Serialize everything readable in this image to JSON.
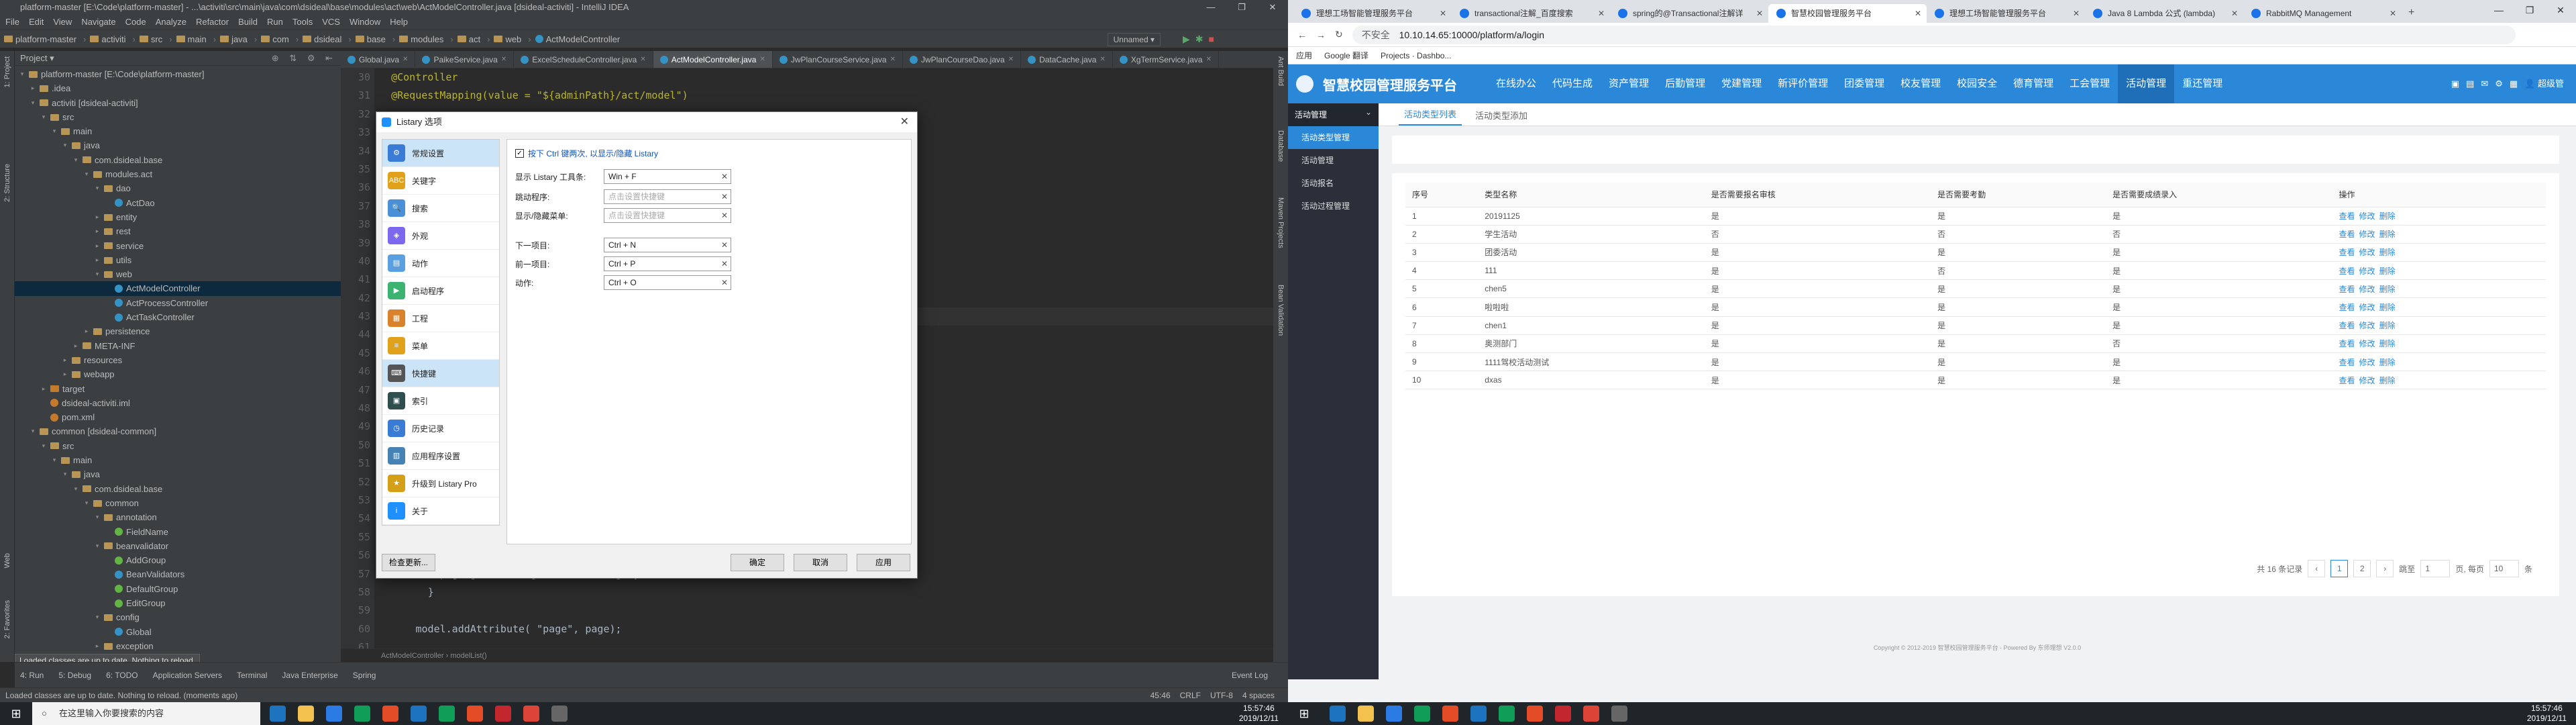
{
  "ide": {
    "title": "platform-master [E:\\Code\\platform-master] - ...\\activiti\\src\\main\\java\\com\\dsideal\\base\\modules\\act\\web\\ActModelController.java [dsideal-activiti] - IntelliJ IDEA",
    "window_controls": [
      "—",
      "❐",
      "✕"
    ],
    "menu": [
      "File",
      "Edit",
      "View",
      "Navigate",
      "Code",
      "Analyze",
      "Refactor",
      "Build",
      "Run",
      "Tools",
      "VCS",
      "Window",
      "Help"
    ],
    "breadcrumb": [
      "platform-master",
      "activiti",
      "src",
      "main",
      "java",
      "com",
      "dsideal",
      "base",
      "modules",
      "act",
      "web",
      "ActModelController"
    ],
    "run_config": "Unnamed ▾",
    "project_label": "Project ▾",
    "side_tabs": [
      "1: Project",
      "2: Structure",
      "Web",
      "2: Favorites"
    ],
    "right_tabs": [
      "Ant Build",
      "Database",
      "Maven Projects",
      "Bean Validation"
    ],
    "tree": [
      {
        "label": "platform-master [E:\\Code\\platform-master]",
        "depth": 0,
        "kind": "folder",
        "arrow": "▾"
      },
      {
        "label": ".idea",
        "depth": 1,
        "kind": "folder",
        "arrow": "▸"
      },
      {
        "label": "activiti [dsideal-activiti]",
        "depth": 1,
        "kind": "folder",
        "arrow": "▾"
      },
      {
        "label": "src",
        "depth": 2,
        "kind": "folder",
        "arrow": "▾"
      },
      {
        "label": "main",
        "depth": 3,
        "kind": "folder",
        "arrow": "▾"
      },
      {
        "label": "java",
        "depth": 4,
        "kind": "folder",
        "arrow": "▾"
      },
      {
        "label": "com.dsideal.base",
        "depth": 5,
        "kind": "folder",
        "arrow": "▾"
      },
      {
        "label": "modules.act",
        "depth": 6,
        "kind": "folder",
        "arrow": "▾"
      },
      {
        "label": "dao",
        "depth": 7,
        "kind": "folder",
        "arrow": "▾"
      },
      {
        "label": "ActDao",
        "depth": 8,
        "kind": "class",
        "arrow": ""
      },
      {
        "label": "entity",
        "depth": 7,
        "kind": "folder",
        "arrow": "▸"
      },
      {
        "label": "rest",
        "depth": 7,
        "kind": "folder",
        "arrow": "▸"
      },
      {
        "label": "service",
        "depth": 7,
        "kind": "folder",
        "arrow": "▸"
      },
      {
        "label": "utils",
        "depth": 7,
        "kind": "folder",
        "arrow": "▸"
      },
      {
        "label": "web",
        "depth": 7,
        "kind": "folder",
        "arrow": "▾"
      },
      {
        "label": "ActModelController",
        "depth": 8,
        "kind": "class",
        "arrow": "",
        "selected": true
      },
      {
        "label": "ActProcessController",
        "depth": 8,
        "kind": "class",
        "arrow": ""
      },
      {
        "label": "ActTaskController",
        "depth": 8,
        "kind": "class",
        "arrow": ""
      },
      {
        "label": "persistence",
        "depth": 6,
        "kind": "folder",
        "arrow": "▸"
      },
      {
        "label": "META-INF",
        "depth": 5,
        "kind": "folder",
        "arrow": "▸"
      },
      {
        "label": "resources",
        "depth": 4,
        "kind": "folder",
        "arrow": "▸"
      },
      {
        "label": "webapp",
        "depth": 4,
        "kind": "folder",
        "arrow": "▸"
      },
      {
        "label": "target",
        "depth": 2,
        "kind": "folder-o",
        "arrow": "▸"
      },
      {
        "label": "dsideal-activiti.iml",
        "depth": 2,
        "kind": "file",
        "arrow": ""
      },
      {
        "label": "pom.xml",
        "depth": 2,
        "kind": "file",
        "arrow": ""
      },
      {
        "label": "common [dsideal-common]",
        "depth": 1,
        "kind": "folder",
        "arrow": "▾"
      },
      {
        "label": "src",
        "depth": 2,
        "kind": "folder",
        "arrow": "▾"
      },
      {
        "label": "main",
        "depth": 3,
        "kind": "folder",
        "arrow": "▾"
      },
      {
        "label": "java",
        "depth": 4,
        "kind": "folder",
        "arrow": "▾"
      },
      {
        "label": "com.dsideal.base",
        "depth": 5,
        "kind": "folder",
        "arrow": "▾"
      },
      {
        "label": "common",
        "depth": 6,
        "kind": "folder",
        "arrow": "▾"
      },
      {
        "label": "annotation",
        "depth": 7,
        "kind": "folder",
        "arrow": "▾"
      },
      {
        "label": "FieldName",
        "depth": 8,
        "kind": "class-g",
        "arrow": ""
      },
      {
        "label": "beanvalidator",
        "depth": 7,
        "kind": "folder",
        "arrow": "▾"
      },
      {
        "label": "AddGroup",
        "depth": 8,
        "kind": "class-g",
        "arrow": ""
      },
      {
        "label": "BeanValidators",
        "depth": 8,
        "kind": "class",
        "arrow": ""
      },
      {
        "label": "DefaultGroup",
        "depth": 8,
        "kind": "class-g",
        "arrow": ""
      },
      {
        "label": "EditGroup",
        "depth": 8,
        "kind": "class-g",
        "arrow": ""
      },
      {
        "label": "config",
        "depth": 7,
        "kind": "folder",
        "arrow": "▾"
      },
      {
        "label": "Global",
        "depth": 8,
        "kind": "class",
        "arrow": ""
      },
      {
        "label": "exception",
        "depth": 7,
        "kind": "folder",
        "arrow": "▸"
      }
    ],
    "tabs": [
      {
        "label": "Global.java",
        "active": false
      },
      {
        "label": "PaikeService.java",
        "active": false
      },
      {
        "label": "ExcelScheduleController.java",
        "active": false
      },
      {
        "label": "ActModelController.java",
        "active": true
      },
      {
        "label": "JwPlanCourseService.java",
        "active": false
      },
      {
        "label": "JwPlanCourseDao.java",
        "active": false
      },
      {
        "label": "DataCache.java",
        "active": false
      },
      {
        "label": "XgTermService.java",
        "active": false
      }
    ],
    "line_numbers": [
      "30",
      "31",
      "32",
      "33",
      "34",
      "35",
      "36",
      "37",
      "38",
      "39",
      "40",
      "41",
      "42",
      "43",
      "44",
      "45",
      "46",
      "47",
      "48",
      "49",
      "50",
      "51",
      "52",
      "53",
      "54",
      "55",
      "56",
      "57",
      "58",
      "59",
      "60",
      "61",
      "62"
    ],
    "code_lines": [
      {
        "text": "@Controller",
        "cls": "ann",
        "indent": 1
      },
      {
        "text": "@RequestMapping(value = \"${adminPath}/act/model\")",
        "cls": "ann",
        "indent": 1
      },
      {
        "text": "",
        "cls": "",
        "indent": 0
      },
      {
        "text": "",
        "cls": "",
        "indent": 0
      },
      {
        "text": "",
        "cls": "",
        "indent": 0
      },
      {
        "text": "",
        "cls": "",
        "indent": 0
      },
      {
        "text": "",
        "cls": "",
        "indent": 0
      },
      {
        "text": "",
        "cls": "",
        "indent": 0
      },
      {
        "text": "",
        "cls": "",
        "indent": 0
      },
      {
        "text": "",
        "cls": "",
        "indent": 0
      },
      {
        "text": "",
        "cls": "",
        "indent": 0
      },
      {
        "text": "",
        "cls": "",
        "indent": 0
      },
      {
        "text": "sponse response, Model model) {",
        "cls": "",
        "indent": 44
      },
      {
        "text": "",
        "cls": "",
        "indent": 0,
        "cur": true
      },
      {
        "text": "",
        "cls": "",
        "indent": 0
      },
      {
        "text": "",
        "cls": "",
        "indent": 0
      },
      {
        "text": "",
        "cls": "",
        "indent": 0
      },
      {
        "text": "",
        "cls": "",
        "indent": 0
      },
      {
        "text": "",
        "cls": "",
        "indent": 0
      },
      {
        "text": "egory);",
        "cls": "",
        "indent": 44
      },
      {
        "text": "",
        "cls": "",
        "indent": 0
      },
      {
        "text": "",
        "cls": "",
        "indent": 0
      },
      {
        "text": "",
        "cls": "",
        "indent": 0
      },
      {
        "text": "",
        "cls": "",
        "indent": 0
      },
      {
        "text": "",
        "cls": "",
        "indent": 0
      },
      {
        "text": "",
        "cls": "",
        "indent": 0
      },
      {
        "text": "",
        "cls": "",
        "indent": 0
      },
      {
        "text": "page.getList().get(1).setCategory(\"无分类\");",
        "cls": "",
        "indent": 9
      },
      {
        "text": "}",
        "cls": "",
        "indent": 7
      },
      {
        "text": "",
        "cls": "",
        "indent": 0
      },
      {
        "text": "model.addAttribute( \"page\", page);",
        "cls": "",
        "indent": 5
      },
      {
        "text": "",
        "cls": "",
        "indent": 0
      },
      {
        "text": "",
        "cls": "",
        "indent": 0
      }
    ],
    "editor_breadcrumb": "ActModelController  ›  modelList()",
    "bottom_tools": [
      "4: Run",
      "5: Debug",
      "6: TODO",
      "Application Servers",
      "Terminal",
      "Java Enterprise",
      "Spring",
      "Event Log"
    ],
    "notification": "Loaded classes are up to date. Nothing to reload.",
    "status": "Loaded classes are up to date. Nothing to reload. (moments ago)",
    "status_right": [
      "45:46",
      "CRLF",
      "UTF-8",
      "4 spaces"
    ]
  },
  "dialog": {
    "title": "Listary 选项",
    "close": "✕",
    "nav": [
      {
        "label": "常规设置",
        "color": "#3a7bd5",
        "icon": "⚙",
        "selected": true
      },
      {
        "label": "关键字",
        "color": "#e0a21b",
        "icon": "ABC",
        "selected": false
      },
      {
        "label": "搜索",
        "color": "#4a90d9",
        "icon": "🔍",
        "selected": false
      },
      {
        "label": "外观",
        "color": "#7b68ee",
        "icon": "◈",
        "selected": false
      },
      {
        "label": "动作",
        "color": "#5aa0e0",
        "icon": "▤",
        "selected": false
      },
      {
        "label": "启动程序",
        "color": "#3cb371",
        "icon": "▶",
        "selected": false
      },
      {
        "label": "工程",
        "color": "#d9822b",
        "icon": "▦",
        "selected": false
      },
      {
        "label": "菜单",
        "color": "#e0a21b",
        "icon": "≡",
        "selected": false
      },
      {
        "label": "快捷键",
        "color": "#555555",
        "icon": "⌨",
        "selected": true
      },
      {
        "label": "索引",
        "color": "#2f4f4f",
        "icon": "▣",
        "selected": false
      },
      {
        "label": "历史记录",
        "color": "#3a7bd5",
        "icon": "◷",
        "selected": false
      },
      {
        "label": "应用程序设置",
        "color": "#4682b4",
        "icon": "▥",
        "selected": false
      },
      {
        "label": "升级到 Listary Pro",
        "color": "#d4a017",
        "icon": "★",
        "selected": false
      },
      {
        "label": "关于",
        "color": "#1e90ff",
        "icon": "i",
        "selected": false
      }
    ],
    "checkbox_label": "按下 Ctrl 键两次, 以显示/隐藏 Listary",
    "checkbox_checked": "✓",
    "fields": [
      {
        "label": "显示 Listary 工具条:",
        "value": "Win + F",
        "placeholder": false
      },
      {
        "label": "跳动程序:",
        "value": "点击设置快捷键",
        "placeholder": true
      },
      {
        "label": "显示/隐藏菜单:",
        "value": "点击设置快捷键",
        "placeholder": true
      },
      {
        "label": "下一项目:",
        "value": "Ctrl + N",
        "placeholder": false
      },
      {
        "label": "前一项目:",
        "value": "Ctrl + P",
        "placeholder": false
      },
      {
        "label": "动作:",
        "value": "Ctrl + O",
        "placeholder": false
      }
    ],
    "buttons": {
      "check_update": "检查更新...",
      "ok": "确定",
      "cancel": "取消",
      "apply": "应用"
    }
  },
  "browser": {
    "tabs": [
      {
        "label": "理想工场智能管理服务平台",
        "active": false
      },
      {
        "label": "transactional注解_百度搜索",
        "active": false
      },
      {
        "label": "spring的@Transactional注解详",
        "active": false
      },
      {
        "label": "智慧校园管理服务平台",
        "active": true
      },
      {
        "label": "理想工场智能管理服务平台",
        "active": false
      },
      {
        "label": "Java 8 Lambda 公式 (lambda)",
        "active": false
      },
      {
        "label": "RabbitMQ Management",
        "active": false
      }
    ],
    "new_tab": "+",
    "url_prefix": "不安全",
    "url": "10.10.14.65:10000/platform/a/login",
    "bookmarks": [
      "应用",
      "Google 翻译",
      "Projects · Dashbo..."
    ]
  },
  "app": {
    "brand": "智慧校园管理服务平台",
    "nav": [
      "在线办公",
      "代码生成",
      "资产管理",
      "后勤管理",
      "党建管理",
      "新评价管理",
      "团委管理",
      "校友管理",
      "校园安全",
      "德育管理",
      "工会管理",
      "活动管理",
      "重还管理"
    ],
    "active_nav": 11,
    "header_right": [
      "▣",
      "▤",
      "✉",
      "⚙",
      "▦",
      "👤 超级管"
    ],
    "side_group": "活动管理",
    "side_items": [
      "活动类型管理",
      "活动管理",
      "活动报名",
      "活动过程管理"
    ],
    "content_tabs": [
      "活动类型列表",
      "活动类型添加"
    ],
    "table": {
      "headers": [
        "序号",
        "类型名称",
        "是否需要报名审核",
        "是否需要考勤",
        "是否需要成绩录入",
        "操作"
      ],
      "rows": [
        [
          "1",
          "20191125",
          "是",
          "是",
          "是"
        ],
        [
          "2",
          "学生活动",
          "否",
          "否",
          "否"
        ],
        [
          "3",
          "团委活动",
          "是",
          "是",
          "是"
        ],
        [
          "4",
          "111",
          "是",
          "否",
          "是"
        ],
        [
          "5",
          "chen5",
          "是",
          "是",
          "是"
        ],
        [
          "6",
          "啦啦啦",
          "是",
          "是",
          "是"
        ],
        [
          "7",
          "chen1",
          "是",
          "是",
          "是"
        ],
        [
          "8",
          "奥测部门",
          "是",
          "是",
          "否"
        ],
        [
          "9",
          "1111驾校活动测试",
          "是",
          "是",
          "是"
        ],
        [
          "10",
          "dxas",
          "是",
          "是",
          "是"
        ]
      ],
      "actions": [
        "查看",
        "修改",
        "删除"
      ]
    },
    "pager": {
      "total": "共 16 条记录",
      "prev": "‹",
      "pages": [
        "1",
        "2"
      ],
      "next": "›",
      "jump_label": "跳至",
      "jump_value": "1",
      "per_label": "页, 每页",
      "per_value": "10",
      "suffix": "条"
    },
    "footer": "Copyright © 2012-2019 智慧校园管理服务平台 - Powered By 东师理想 V2.0.0"
  },
  "taskbar": {
    "search": "在这里输入你要搜索的内容",
    "time_left": "15:57:46",
    "date_left": "2019/12/11",
    "time_right": "15:57:46",
    "date_right": "2019/12/11",
    "icon_colors": [
      "#1e73be",
      "#f2c14e",
      "#2c7be5",
      "#0f9d58",
      "#e34c26",
      "#1e73be",
      "#0f9d58",
      "#e34c26",
      "#c1272d",
      "#db4437",
      "#666666"
    ]
  }
}
